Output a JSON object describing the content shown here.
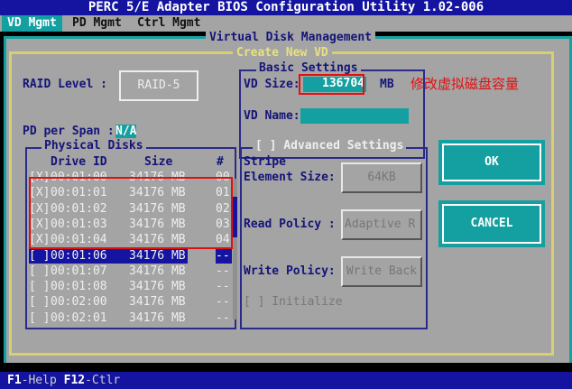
{
  "title": "PERC 5/E Adapter BIOS Configuration Utility 1.02-006",
  "tabs": [
    "VD Mgmt",
    "PD Mgmt",
    "Ctrl Mgmt"
  ],
  "panel_title": "Virtual Disk Management",
  "dialog_title": "Create New VD",
  "raid_level_label": "RAID Level :",
  "raid_level_value": "RAID-5",
  "pd_per_span_label": "PD per Span :",
  "pd_per_span_value": "N/A",
  "basic_settings": {
    "title": "Basic Settings",
    "vd_size_label": "VD Size:",
    "vd_size_value": "136704",
    "vd_size_unit": "MB",
    "vd_name_label": "VD Name:",
    "vd_name_value": ""
  },
  "annotation": "修改虚拟磁盘容量",
  "physical_disks": {
    "title": "Physical Disks",
    "headers": [
      "Drive ID",
      "Size",
      "#"
    ],
    "rows": [
      {
        "check": "[X]",
        "id": "00:01:00",
        "size": "34176 MB",
        "num": "00"
      },
      {
        "check": "[X]",
        "id": "00:01:01",
        "size": "34176 MB",
        "num": "01"
      },
      {
        "check": "[X]",
        "id": "00:01:02",
        "size": "34176 MB",
        "num": "02"
      },
      {
        "check": "[X]",
        "id": "00:01:03",
        "size": "34176 MB",
        "num": "03"
      },
      {
        "check": "[X]",
        "id": "00:01:04",
        "size": "34176 MB",
        "num": "04"
      },
      {
        "check": "[ ]",
        "id": "00:01:06",
        "size": "34176 MB",
        "num": "--"
      },
      {
        "check": "[ ]",
        "id": "00:01:07",
        "size": "34176 MB",
        "num": "--"
      },
      {
        "check": "[ ]",
        "id": "00:01:08",
        "size": "34176 MB",
        "num": "--"
      },
      {
        "check": "[ ]",
        "id": "00:02:00",
        "size": "34176 MB",
        "num": "--"
      },
      {
        "check": "[ ]",
        "id": "00:02:01",
        "size": "34176 MB",
        "num": "--"
      }
    ]
  },
  "advanced": {
    "title": "[ ] Advanced Settings",
    "stripe_label_1": "Stripe",
    "stripe_label_2": "Element Size:",
    "stripe_value": "64KB",
    "read_label": "Read Policy :",
    "read_value": "Adaptive R",
    "write_label": "Write Policy:",
    "write_value": "Write Back",
    "initialize": "[ ] Initialize"
  },
  "buttons": {
    "ok": "OK",
    "cancel": "CANCEL"
  },
  "status_bar": {
    "f1": "F1",
    "f1_text": "-Help ",
    "f12": "F12",
    "f12_text": "-Ctlr"
  }
}
